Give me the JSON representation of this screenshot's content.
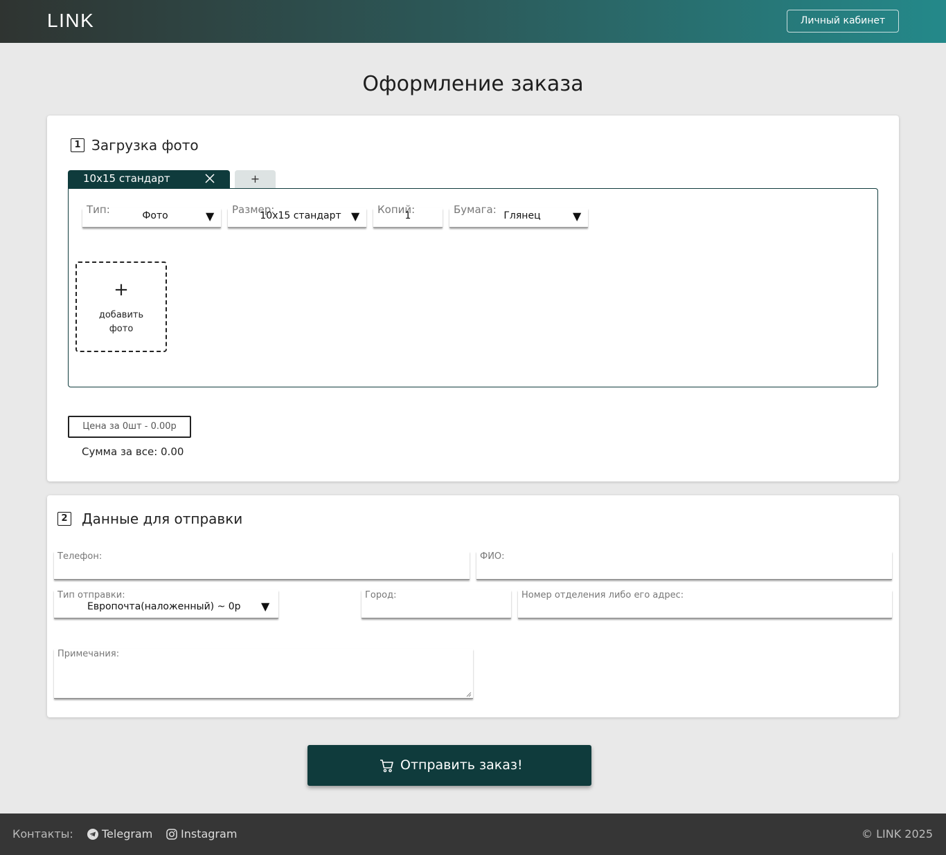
{
  "header": {
    "logo": "LINK",
    "cabinet_label": "Личный кабинет"
  },
  "page_title": "Оформление заказа",
  "step1": {
    "number": "1",
    "title": "Загрузка фото",
    "tabs": [
      {
        "label": "10x15 стандарт",
        "active": true
      }
    ],
    "add_tab_label": "+",
    "fields": {
      "type": {
        "label": "Тип:",
        "value": "Фото"
      },
      "size": {
        "label": "Размер:",
        "value": "10x15 стандарт"
      },
      "copies": {
        "label": "Копий:",
        "value": "1"
      },
      "paper": {
        "label": "Бумага:",
        "value": "Глянец"
      }
    },
    "add_photo": {
      "plus": "+",
      "label_line1": "добавить",
      "label_line2": "фото"
    },
    "price": "Цена за 0шт - 0.00р",
    "total": "Сумма за все: 0.00"
  },
  "step2": {
    "number": "2",
    "title": "Данные для отправки",
    "phone_label": "Телефон:",
    "name_label": "ФИО:",
    "shipping_label": "Тип отправки:",
    "shipping_value": "Европочта(наложенный) ~ 0р",
    "city_label": "Город:",
    "branch_label": "Номер отделения либо его адрес:",
    "notes_label": "Примечания:"
  },
  "submit_label": "Отправить заказ!",
  "footer": {
    "contacts_label": "Контакты:",
    "telegram": "Telegram",
    "instagram": "Instagram",
    "copyright": "LINK 2025"
  },
  "colors": {
    "primary": "#0f3b3c",
    "header_start": "#2f3431",
    "header_end": "#24898a",
    "footer": "#363636"
  }
}
